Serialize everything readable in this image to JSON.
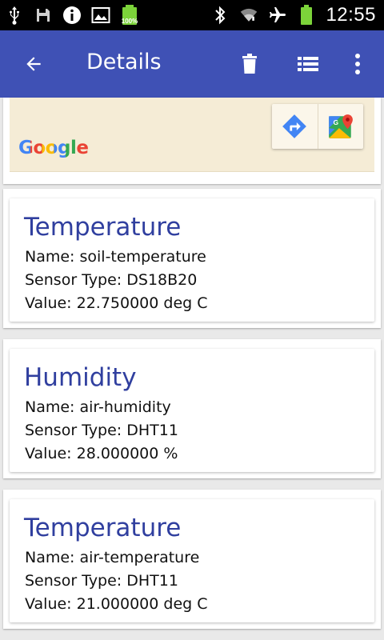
{
  "status_bar": {
    "battery_percent": "100%",
    "time": "12:55",
    "icons": [
      "usb-icon",
      "save-icon",
      "info-icon",
      "image-icon",
      "battery-charging-icon",
      "bluetooth-icon",
      "wifi-icon",
      "airplane-icon",
      "battery-icon"
    ]
  },
  "app_bar": {
    "title": "Details",
    "actions": [
      "back-arrow-icon",
      "delete-icon",
      "list-icon",
      "overflow-menu-icon"
    ],
    "color": "#3f51b5"
  },
  "map": {
    "logo_text": "Google",
    "tools": [
      "directions-icon",
      "google-maps-icon"
    ]
  },
  "sensors": [
    {
      "title": "Temperature",
      "name_line": "Name: soil-temperature",
      "type_line": "Sensor Type: DS18B20",
      "value_line": "Value: 22.750000 deg C"
    },
    {
      "title": "Humidity",
      "name_line": "Name: air-humidity",
      "type_line": "Sensor Type: DHT11",
      "value_line": "Value: 28.000000 %"
    },
    {
      "title": "Temperature",
      "name_line": "Name: air-temperature",
      "type_line": "Sensor Type: DHT11",
      "value_line": "Value: 21.000000 deg C"
    }
  ]
}
